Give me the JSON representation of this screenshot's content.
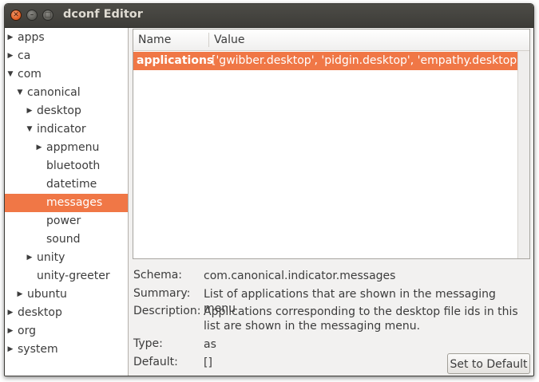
{
  "window": {
    "title": "dconf Editor"
  },
  "titlebar_buttons": {
    "close": "✕",
    "minimize": "–",
    "maximize": "□"
  },
  "tree": [
    {
      "label": "apps",
      "arrow": "▶",
      "depth": 0,
      "selected": false
    },
    {
      "label": "ca",
      "arrow": "▶",
      "depth": 0,
      "selected": false
    },
    {
      "label": "com",
      "arrow": "▼",
      "depth": 0,
      "selected": false
    },
    {
      "label": "canonical",
      "arrow": "▼",
      "depth": 1,
      "selected": false
    },
    {
      "label": "desktop",
      "arrow": "▶",
      "depth": 2,
      "selected": false
    },
    {
      "label": "indicator",
      "arrow": "▼",
      "depth": 2,
      "selected": false
    },
    {
      "label": "appmenu",
      "arrow": "▶",
      "depth": 3,
      "selected": false
    },
    {
      "label": "bluetooth",
      "arrow": "",
      "depth": 3,
      "selected": false
    },
    {
      "label": "datetime",
      "arrow": "",
      "depth": 3,
      "selected": false
    },
    {
      "label": "messages",
      "arrow": "",
      "depth": 3,
      "selected": true
    },
    {
      "label": "power",
      "arrow": "",
      "depth": 3,
      "selected": false
    },
    {
      "label": "sound",
      "arrow": "",
      "depth": 3,
      "selected": false
    },
    {
      "label": "unity",
      "arrow": "▶",
      "depth": 2,
      "selected": false
    },
    {
      "label": "unity-greeter",
      "arrow": "",
      "depth": 2,
      "selected": false
    },
    {
      "label": "ubuntu",
      "arrow": "▶",
      "depth": 1,
      "selected": false
    },
    {
      "label": "desktop",
      "arrow": "▶",
      "depth": 0,
      "selected": false
    },
    {
      "label": "org",
      "arrow": "▶",
      "depth": 0,
      "selected": false
    },
    {
      "label": "system",
      "arrow": "▶",
      "depth": 0,
      "selected": false
    }
  ],
  "list": {
    "columns": {
      "name": "Name",
      "value": "Value"
    },
    "rows": [
      {
        "name": "applications",
        "value": "['gwibber.desktop', 'pidgin.desktop', 'empathy.desktop']"
      }
    ]
  },
  "details": {
    "schema_label": "Schema:",
    "schema": "com.canonical.indicator.messages",
    "summary_label": "Summary:",
    "summary": "List of applications that are shown in the messaging menu",
    "description_label": "Description:",
    "description": "Applications corresponding to the desktop file ids in this list are shown in the messaging menu.",
    "type_label": "Type:",
    "type": "as",
    "default_label": "Default:",
    "default": "[]"
  },
  "buttons": {
    "set_default": "Set to Default"
  },
  "colors": {
    "selection": "#f07746",
    "titlebar": "#3d3c38",
    "close": "#e05a1f"
  }
}
